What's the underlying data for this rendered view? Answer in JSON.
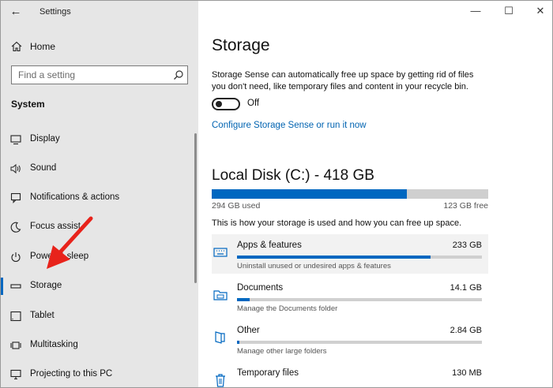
{
  "window": {
    "title": "Settings",
    "controls": {
      "minimize": "—",
      "maximize": "☐",
      "close": "✕"
    }
  },
  "sidebar": {
    "home_label": "Home",
    "search_placeholder": "Find a setting",
    "section_title": "System",
    "items": [
      {
        "label": "Display",
        "icon": "monitor-icon"
      },
      {
        "label": "Sound",
        "icon": "speaker-icon"
      },
      {
        "label": "Notifications & actions",
        "icon": "notifications-icon"
      },
      {
        "label": "Focus assist",
        "icon": "moon-icon"
      },
      {
        "label": "Power & sleep",
        "icon": "power-icon"
      },
      {
        "label": "Storage",
        "icon": "storage-drive-icon",
        "active": true
      },
      {
        "label": "Tablet",
        "icon": "tablet-icon"
      },
      {
        "label": "Multitasking",
        "icon": "multitasking-icon"
      },
      {
        "label": "Projecting to this PC",
        "icon": "projecting-icon"
      }
    ]
  },
  "main": {
    "title": "Storage",
    "storage_sense_description": "Storage Sense can automatically free up space by getting rid of files you don't need, like temporary files and content in your recycle bin.",
    "toggle_state": "Off",
    "configure_link": "Configure Storage Sense or run it now",
    "disk": {
      "title": "Local Disk (C:) - 418 GB",
      "used": "294 GB used",
      "free": "123 GB free",
      "used_fraction": 0.705
    },
    "info_line": "This is how your storage is used and how you can free up space.",
    "categories": [
      {
        "name": "Apps & features",
        "size": "233 GB",
        "sub": "Uninstall unused or undesired apps & features",
        "fraction": 0.79,
        "icon": "keyboard-icon"
      },
      {
        "name": "Documents",
        "size": "14.1 GB",
        "sub": "Manage the Documents folder",
        "fraction": 0.05,
        "icon": "folder-icon"
      },
      {
        "name": "Other",
        "size": "2.84 GB",
        "sub": "Manage other large folders",
        "fraction": 0.01,
        "icon": "other-files-icon"
      },
      {
        "name": "Temporary files",
        "size": "130 MB",
        "sub": "",
        "fraction": 0.005,
        "icon": "trash-icon"
      }
    ]
  },
  "colors": {
    "accent": "#0067c0",
    "sidebar_bg": "#e6e6e6",
    "link": "#0063b1",
    "annotation_arrow": "#e8231b"
  }
}
